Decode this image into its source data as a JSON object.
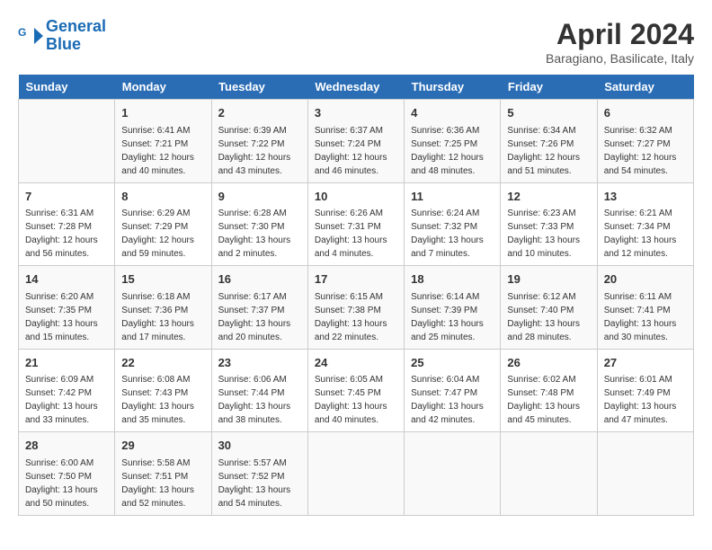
{
  "header": {
    "logo_line1": "General",
    "logo_line2": "Blue",
    "month": "April 2024",
    "location": "Baragiano, Basilicate, Italy"
  },
  "days_of_week": [
    "Sunday",
    "Monday",
    "Tuesday",
    "Wednesday",
    "Thursday",
    "Friday",
    "Saturday"
  ],
  "weeks": [
    [
      {
        "day": "",
        "info": ""
      },
      {
        "day": "1",
        "info": "Sunrise: 6:41 AM\nSunset: 7:21 PM\nDaylight: 12 hours\nand 40 minutes."
      },
      {
        "day": "2",
        "info": "Sunrise: 6:39 AM\nSunset: 7:22 PM\nDaylight: 12 hours\nand 43 minutes."
      },
      {
        "day": "3",
        "info": "Sunrise: 6:37 AM\nSunset: 7:24 PM\nDaylight: 12 hours\nand 46 minutes."
      },
      {
        "day": "4",
        "info": "Sunrise: 6:36 AM\nSunset: 7:25 PM\nDaylight: 12 hours\nand 48 minutes."
      },
      {
        "day": "5",
        "info": "Sunrise: 6:34 AM\nSunset: 7:26 PM\nDaylight: 12 hours\nand 51 minutes."
      },
      {
        "day": "6",
        "info": "Sunrise: 6:32 AM\nSunset: 7:27 PM\nDaylight: 12 hours\nand 54 minutes."
      }
    ],
    [
      {
        "day": "7",
        "info": "Sunrise: 6:31 AM\nSunset: 7:28 PM\nDaylight: 12 hours\nand 56 minutes."
      },
      {
        "day": "8",
        "info": "Sunrise: 6:29 AM\nSunset: 7:29 PM\nDaylight: 12 hours\nand 59 minutes."
      },
      {
        "day": "9",
        "info": "Sunrise: 6:28 AM\nSunset: 7:30 PM\nDaylight: 13 hours\nand 2 minutes."
      },
      {
        "day": "10",
        "info": "Sunrise: 6:26 AM\nSunset: 7:31 PM\nDaylight: 13 hours\nand 4 minutes."
      },
      {
        "day": "11",
        "info": "Sunrise: 6:24 AM\nSunset: 7:32 PM\nDaylight: 13 hours\nand 7 minutes."
      },
      {
        "day": "12",
        "info": "Sunrise: 6:23 AM\nSunset: 7:33 PM\nDaylight: 13 hours\nand 10 minutes."
      },
      {
        "day": "13",
        "info": "Sunrise: 6:21 AM\nSunset: 7:34 PM\nDaylight: 13 hours\nand 12 minutes."
      }
    ],
    [
      {
        "day": "14",
        "info": "Sunrise: 6:20 AM\nSunset: 7:35 PM\nDaylight: 13 hours\nand 15 minutes."
      },
      {
        "day": "15",
        "info": "Sunrise: 6:18 AM\nSunset: 7:36 PM\nDaylight: 13 hours\nand 17 minutes."
      },
      {
        "day": "16",
        "info": "Sunrise: 6:17 AM\nSunset: 7:37 PM\nDaylight: 13 hours\nand 20 minutes."
      },
      {
        "day": "17",
        "info": "Sunrise: 6:15 AM\nSunset: 7:38 PM\nDaylight: 13 hours\nand 22 minutes."
      },
      {
        "day": "18",
        "info": "Sunrise: 6:14 AM\nSunset: 7:39 PM\nDaylight: 13 hours\nand 25 minutes."
      },
      {
        "day": "19",
        "info": "Sunrise: 6:12 AM\nSunset: 7:40 PM\nDaylight: 13 hours\nand 28 minutes."
      },
      {
        "day": "20",
        "info": "Sunrise: 6:11 AM\nSunset: 7:41 PM\nDaylight: 13 hours\nand 30 minutes."
      }
    ],
    [
      {
        "day": "21",
        "info": "Sunrise: 6:09 AM\nSunset: 7:42 PM\nDaylight: 13 hours\nand 33 minutes."
      },
      {
        "day": "22",
        "info": "Sunrise: 6:08 AM\nSunset: 7:43 PM\nDaylight: 13 hours\nand 35 minutes."
      },
      {
        "day": "23",
        "info": "Sunrise: 6:06 AM\nSunset: 7:44 PM\nDaylight: 13 hours\nand 38 minutes."
      },
      {
        "day": "24",
        "info": "Sunrise: 6:05 AM\nSunset: 7:45 PM\nDaylight: 13 hours\nand 40 minutes."
      },
      {
        "day": "25",
        "info": "Sunrise: 6:04 AM\nSunset: 7:47 PM\nDaylight: 13 hours\nand 42 minutes."
      },
      {
        "day": "26",
        "info": "Sunrise: 6:02 AM\nSunset: 7:48 PM\nDaylight: 13 hours\nand 45 minutes."
      },
      {
        "day": "27",
        "info": "Sunrise: 6:01 AM\nSunset: 7:49 PM\nDaylight: 13 hours\nand 47 minutes."
      }
    ],
    [
      {
        "day": "28",
        "info": "Sunrise: 6:00 AM\nSunset: 7:50 PM\nDaylight: 13 hours\nand 50 minutes."
      },
      {
        "day": "29",
        "info": "Sunrise: 5:58 AM\nSunset: 7:51 PM\nDaylight: 13 hours\nand 52 minutes."
      },
      {
        "day": "30",
        "info": "Sunrise: 5:57 AM\nSunset: 7:52 PM\nDaylight: 13 hours\nand 54 minutes."
      },
      {
        "day": "",
        "info": ""
      },
      {
        "day": "",
        "info": ""
      },
      {
        "day": "",
        "info": ""
      },
      {
        "day": "",
        "info": ""
      }
    ]
  ]
}
